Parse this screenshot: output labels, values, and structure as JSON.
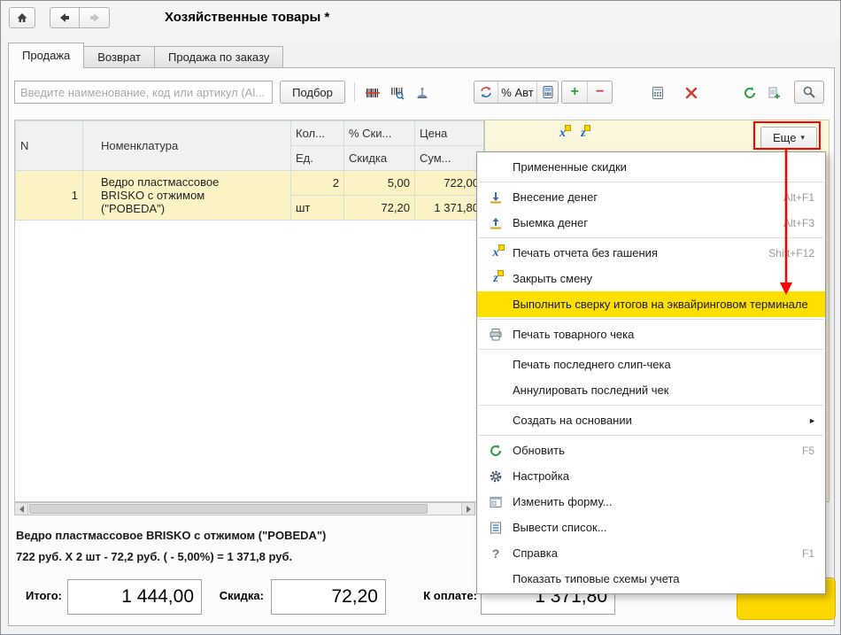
{
  "window": {
    "title": "Хозяйственные товары *"
  },
  "tabs": [
    {
      "label": "Продажа",
      "active": true
    },
    {
      "label": "Возврат",
      "active": false
    },
    {
      "label": "Продажа по заказу",
      "active": false
    }
  ],
  "toolbar": {
    "search_placeholder": "Введите наименование, код или артикул (Al...",
    "podbor": "Подбор",
    "avt": "% Авт",
    "esche": "Еще"
  },
  "glyphs": {
    "plus": "+",
    "minus": "−",
    "caret": "▾",
    "submenu": "►",
    "x_letter": "x",
    "z_letter": "z",
    "question": "?"
  },
  "table": {
    "header": {
      "n": "N",
      "nomenclature": "Номенклатура",
      "qty": "Кол...",
      "unit": "Ед.",
      "discount_pct": "% Ски...",
      "discount": "Скидка",
      "price": "Цена",
      "sum": "Сум..."
    },
    "row": {
      "n": "1",
      "nomenclature": "Ведро пластмассовое BRISKO с отжимом (\"POBEDA\")",
      "qty": "2",
      "unit": "шт",
      "discount_pct": "5,00",
      "discount": "72,20",
      "price": "722,00",
      "sum": "1 371,80"
    }
  },
  "menu": {
    "items": [
      {
        "label": "Примененные скидки",
        "shortcut": ""
      },
      {
        "label": "Внесение денег",
        "shortcut": "Alt+F1"
      },
      {
        "label": "Выемка денег",
        "shortcut": "Alt+F3"
      },
      {
        "label": "Печать отчета без гашения",
        "shortcut": "Shift+F12"
      },
      {
        "label": "Закрыть смену",
        "shortcut": ""
      },
      {
        "label": "Выполнить сверку итогов на эквайринговом терминале",
        "shortcut": ""
      },
      {
        "label": "Печать товарного чека",
        "shortcut": ""
      },
      {
        "label": "Печать последнего слип-чека",
        "shortcut": ""
      },
      {
        "label": "Аннулировать последний чек",
        "shortcut": ""
      },
      {
        "label": "Создать на основании",
        "shortcut": "",
        "arrow": "►"
      },
      {
        "label": "Обновить",
        "shortcut": "F5"
      },
      {
        "label": "Настройка",
        "shortcut": ""
      },
      {
        "label": "Изменить форму...",
        "shortcut": ""
      },
      {
        "label": "Вывести список...",
        "shortcut": ""
      },
      {
        "label": "Справка",
        "shortcut": "F1"
      },
      {
        "label": "Показать типовые схемы учета",
        "shortcut": ""
      }
    ]
  },
  "info": {
    "line1": "Ведро пластмассовое BRISKO с отжимом (\"POBEDA\")",
    "line2": "722 руб. X 2 шт - 72,2 руб. ( - 5,00%) = 1 371,8 руб."
  },
  "totals": {
    "itogo_label": "Итого:",
    "itogo": "1 444,00",
    "skidka_label": "Скидка:",
    "skidka": "72,20",
    "k_oplate_label": "К оплате:",
    "k_oplate": "1 371,80"
  },
  "colors": {
    "menu_highlight": "#ffdf00",
    "annotation_red": "#fe0000",
    "selected_row": "#fcf3c5",
    "current_cell": "#fde358",
    "side_panel": "#fbf7dd",
    "pay_button": "#ffd800"
  }
}
